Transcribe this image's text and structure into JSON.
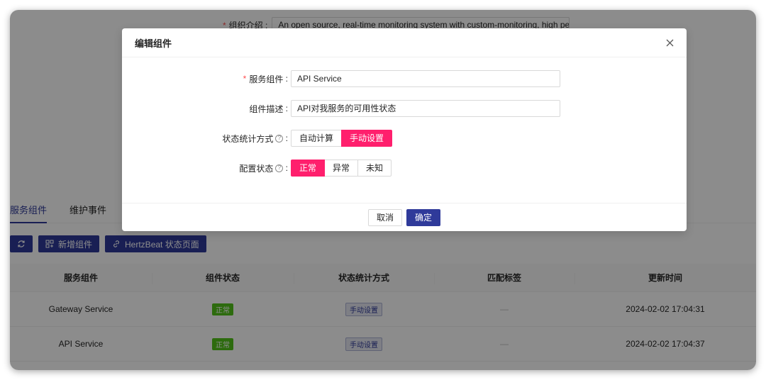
{
  "background": {
    "intro_label": "组织介绍",
    "intro_value": "An open source, real-time monitoring system with custom-monitoring, high performance",
    "tabs": [
      {
        "label": "服务组件",
        "active": true
      },
      {
        "label": "维护事件",
        "active": false
      }
    ],
    "toolbar": {
      "refresh_icon": "refresh-icon",
      "add_label": "新增组件",
      "hertzbeat_label": "HertzBeat 状态页面"
    },
    "table": {
      "headers": [
        "服务组件",
        "组件状态",
        "状态统计方式",
        "匹配标签",
        "更新时间"
      ],
      "rows": [
        {
          "name": "Gateway Service",
          "status": "正常",
          "method": "手动设置",
          "tags": "—",
          "updated": "2024-02-02 17:04:31"
        },
        {
          "name": "API Service",
          "status": "正常",
          "method": "手动设置",
          "tags": "—",
          "updated": "2024-02-02 17:04:37"
        }
      ]
    }
  },
  "modal": {
    "title": "编辑组件",
    "close_icon": "close-icon",
    "fields": {
      "service": {
        "label": "服务组件",
        "value": "API Service"
      },
      "description": {
        "label": "组件描述",
        "value": "API对我服务的可用性状态"
      },
      "method": {
        "label": "状态统计方式",
        "options": [
          "自动计算",
          "手动设置"
        ],
        "selected": "手动设置"
      },
      "state": {
        "label": "配置状态",
        "options": [
          "正常",
          "异常",
          "未知"
        ],
        "selected": "正常"
      }
    },
    "cancel_label": "取消",
    "ok_label": "确定"
  },
  "colors": {
    "primary": "#2f3a9a",
    "accent": "#ff1f6d",
    "success": "#52c41a"
  }
}
